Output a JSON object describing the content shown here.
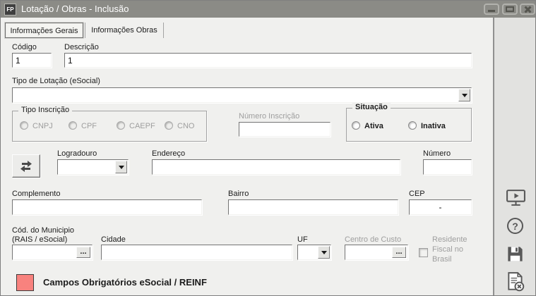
{
  "window": {
    "title": "Lotação / Obras - Inclusão",
    "app_icon": "FP"
  },
  "tabs": [
    {
      "label": "Informações Gerais",
      "active": true
    },
    {
      "label": "Informações Obras",
      "active": false
    }
  ],
  "form": {
    "codigo": {
      "label": "Código",
      "value": "1"
    },
    "descricao": {
      "label": "Descrição",
      "value": "1"
    },
    "tipo_lotacao": {
      "label": "Tipo de Lotação (eSocial)",
      "value": ""
    },
    "tipo_inscricao": {
      "legend": "Tipo Inscrição",
      "options": [
        {
          "label": "CNPJ"
        },
        {
          "label": "CPF"
        },
        {
          "label": "CAEPF"
        },
        {
          "label": "CNO"
        }
      ]
    },
    "numero_inscricao": {
      "label": "Número Inscrição",
      "value": ""
    },
    "situacao": {
      "legend": "Situação",
      "options": [
        {
          "label": "Ativa"
        },
        {
          "label": "Inativa"
        }
      ]
    },
    "logradouro": {
      "label": "Logradouro",
      "value": ""
    },
    "endereco": {
      "label": "Endereço",
      "value": ""
    },
    "numero": {
      "label": "Número",
      "value": ""
    },
    "complemento": {
      "label": "Complemento",
      "value": ""
    },
    "bairro": {
      "label": "Bairro",
      "value": ""
    },
    "cep": {
      "label": "CEP",
      "value": "-"
    },
    "cod_municipio": {
      "label_line1": "Cód. do Municipio",
      "label_line2": "(RAIS / eSocial)",
      "value": ""
    },
    "cidade": {
      "label": "Cidade",
      "value": ""
    },
    "uf": {
      "label": "UF",
      "value": ""
    },
    "centro_custo": {
      "label": "Centro de Custo",
      "value": ""
    },
    "residente_fiscal": {
      "label": "Residente Fiscal no Brasil"
    },
    "browse_button_label": "..."
  },
  "legend_note": {
    "text": "Campos Obrigatórios eSocial / REINF",
    "color": "#f8827e"
  },
  "sidebar": {
    "help_glyph": "?",
    "icons": [
      "video-tutorial",
      "help",
      "save",
      "cancel-record"
    ]
  },
  "colors": {
    "titlebar": "#8b8b86",
    "panel": "#f0f0ee",
    "sidebar": "#e2e2e0",
    "required_field": "#f8827e"
  }
}
